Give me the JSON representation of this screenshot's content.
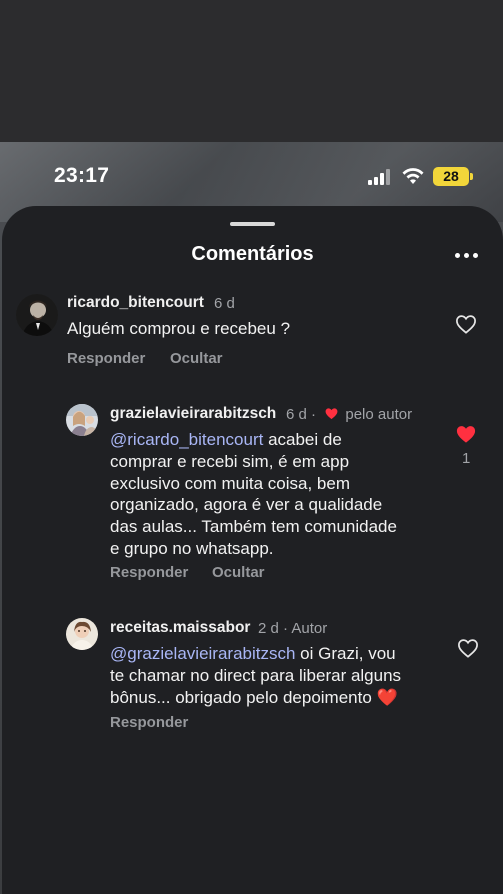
{
  "status_bar": {
    "time": "23:17",
    "battery": "28"
  },
  "sheet": {
    "title": "Comentários"
  },
  "comments": [
    {
      "username": "ricardo_bitencourt",
      "age": "6 d",
      "text": "Alguém comprou e recebeu ?",
      "actions": {
        "reply": "Responder",
        "hide": "Ocultar"
      },
      "liked": false
    },
    {
      "username": "grazielavieirarabitzsch",
      "age": "6 d ·",
      "author_badge": "pelo autor",
      "mention": "@ricardo_bitencourt",
      "text_lines": [
        " acabei de",
        "comprar e recebi sim, é em app",
        "exclusivo com muita coisa, bem",
        "organizado, agora é ver a qualidade",
        "das aulas... Também tem comunidade",
        "e grupo no whatsapp."
      ],
      "actions": {
        "reply": "Responder",
        "hide": "Ocultar"
      },
      "liked": true,
      "likes": "1"
    },
    {
      "username": "receitas.maissabor",
      "age": "2 d · Autor",
      "mention": "@grazielavieirarabitzsch",
      "text_lines": [
        " oi Grazi, vou",
        "te chamar no direct para liberar alguns",
        "bônus... obrigado pelo depoimento ❤️"
      ],
      "actions": {
        "reply": "Responder"
      },
      "liked": false
    }
  ],
  "colors": {
    "sheet_bg": "#1f2023",
    "mention": "#a9b6f5",
    "like_red": "#ff3040",
    "battery": "#f2d63a"
  }
}
